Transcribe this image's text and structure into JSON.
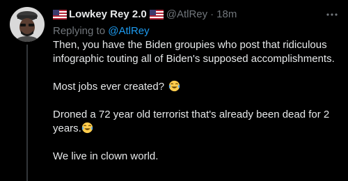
{
  "tweet": {
    "display_name": "Lowkey Rey 2.0",
    "handle": "@AtlRey",
    "separator": "·",
    "time": "18m",
    "replying_prefix": "Replying to ",
    "replying_handle": "@AtlRey",
    "paragraphs": [
      "Then, you have the Biden groupies who post that ridiculous infographic touting all of Biden's supposed accomplishments.",
      "Most jobs ever created?",
      "Droned a 72 year old terrorist that's already been dead for 2 years.",
      "We live in clown world."
    ],
    "icons": {
      "flags": "us-flag-icon",
      "emoji": "tears-of-joy-emoji",
      "more": "more-options-icon"
    }
  },
  "colors": {
    "background": "#000000",
    "text": "#e7e9ea",
    "secondary": "#71767b",
    "link": "#1d9bf0",
    "thread_line": "#333639"
  }
}
